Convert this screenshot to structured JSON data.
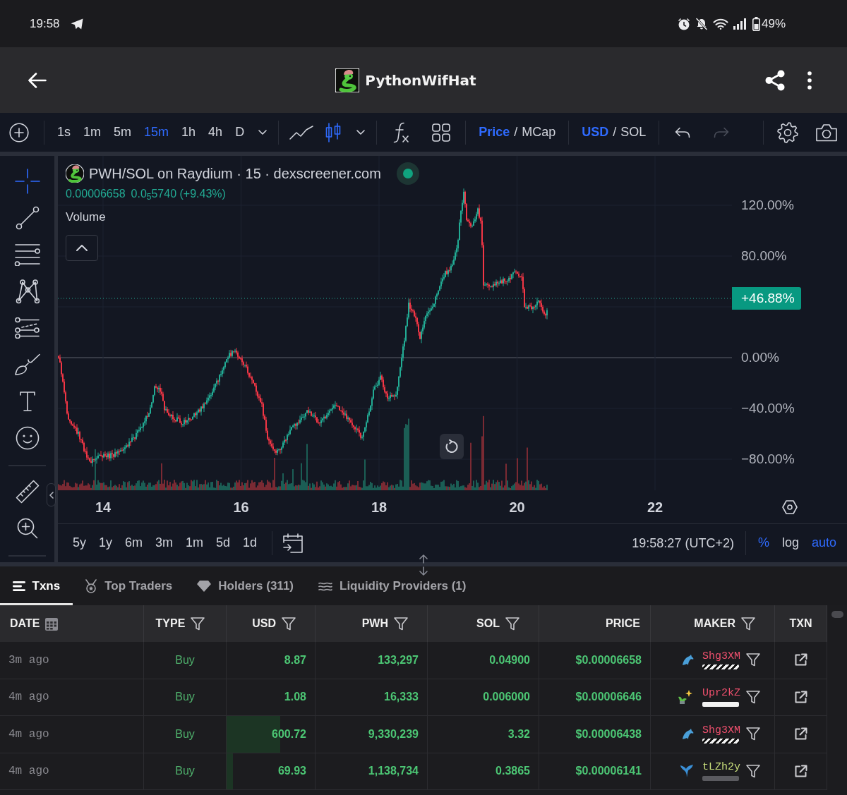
{
  "status_bar": {
    "time": "19:58",
    "battery": "49%"
  },
  "header": {
    "title": "PythonWifHat"
  },
  "toolbar": {
    "intervals": [
      {
        "label": "1s",
        "selected": false
      },
      {
        "label": "1m",
        "selected": false
      },
      {
        "label": "5m",
        "selected": false
      },
      {
        "label": "15m",
        "selected": true
      },
      {
        "label": "1h",
        "selected": false
      },
      {
        "label": "4h",
        "selected": false
      },
      {
        "label": "D",
        "selected": false
      }
    ],
    "chart_styles": [
      {
        "kind": "line",
        "selected": false
      },
      {
        "kind": "candles",
        "selected": true
      }
    ],
    "value_toggle": {
      "options": [
        {
          "label": "Price",
          "selected": true
        },
        {
          "label": "MCap",
          "selected": false
        }
      ],
      "divider": "/"
    },
    "currency_toggle": {
      "options": [
        {
          "label": "USD",
          "selected": true
        },
        {
          "label": "SOL",
          "selected": false
        }
      ],
      "divider": "/"
    },
    "history": [
      {
        "kind": "undo",
        "disabled": false
      },
      {
        "kind": "redo",
        "disabled": true
      }
    ]
  },
  "drawing_tools": [
    [
      {
        "kind": "crosshair",
        "selected": true
      },
      {
        "kind": "trend_line",
        "selected": false
      },
      {
        "kind": "fib_levels",
        "selected": false
      },
      {
        "kind": "pattern",
        "selected": false
      },
      {
        "kind": "projection",
        "selected": false
      },
      {
        "kind": "brush",
        "selected": false
      },
      {
        "kind": "text",
        "selected": false
      },
      {
        "kind": "emoji",
        "selected": false
      }
    ],
    [
      {
        "kind": "measure",
        "selected": false
      },
      {
        "kind": "zoom_in",
        "selected": false
      }
    ]
  ],
  "chart": {
    "legend": {
      "title": "PWH/SOL on Raydium · 15 · dexscreener.com",
      "price": "0.00006658",
      "change": "0.0$_{5}$5740 (+9.43%)",
      "indicator": "Volume",
      "live": true
    },
    "price_axis": [
      {
        "kind": "tick",
        "label": "120.00%"
      },
      {
        "kind": "tick",
        "label": "80.00%"
      },
      {
        "kind": "last",
        "label": "+46.88%"
      },
      {
        "kind": "baseline",
        "label": "0.00%"
      },
      {
        "kind": "tick",
        "label": "−40.00%"
      },
      {
        "kind": "tick",
        "label": "−80.00%"
      }
    ],
    "time_axis": [
      "14",
      "16",
      "18",
      "20",
      "22"
    ],
    "ranges": [
      {
        "label": "5y",
        "selected": false
      },
      {
        "label": "1y",
        "selected": false
      },
      {
        "label": "6m",
        "selected": false
      },
      {
        "label": "3m",
        "selected": false
      },
      {
        "label": "1m",
        "selected": false
      },
      {
        "label": "5d",
        "selected": false
      },
      {
        "label": "1d",
        "selected": false
      }
    ],
    "clock": "19:58:27 (UTC+2)",
    "scale_options": [
      {
        "label": "%",
        "on": true
      },
      {
        "label": "log",
        "on": false
      },
      {
        "label": "auto",
        "on": true
      }
    ]
  },
  "tabs": [
    {
      "label": "Txns",
      "kind": "txns",
      "selected": true
    },
    {
      "label": "Top Traders",
      "kind": "traders",
      "selected": false
    },
    {
      "label": "Holders (311)",
      "kind": "holders",
      "selected": false
    },
    {
      "label": "Liquidity Providers (1)",
      "kind": "liquidity",
      "selected": false
    }
  ],
  "table": {
    "columns": [
      {
        "label": "DATE",
        "kind": "date"
      },
      {
        "label": "TYPE",
        "kind": "filter"
      },
      {
        "label": "USD",
        "kind": "filter"
      },
      {
        "label": "PWH",
        "kind": "filter"
      },
      {
        "label": "SOL",
        "kind": "filter"
      },
      {
        "label": "PRICE",
        "kind": "plain"
      },
      {
        "label": "MAKER",
        "kind": "filter"
      },
      {
        "label": "TXN",
        "kind": "plain"
      }
    ],
    "rows": [
      {
        "date": "3m ago",
        "type": "Buy",
        "kind": "buy",
        "usd": "8.87",
        "pwh": "133,297",
        "sol": "0.04900",
        "price": "$0.00006658",
        "maker": {
          "address": "Shg3XM",
          "kind": "dolphin",
          "color": "#f0506e",
          "holdings": {
            "kind": "striped"
          }
        }
      },
      {
        "date": "4m ago",
        "type": "Buy",
        "kind": "buy",
        "usd": "1.08",
        "pwh": "16,333",
        "sol": "0.006000",
        "price": "$0.00006646",
        "maker": {
          "address": "Upr2kZ",
          "kind": "fresh",
          "color": "#f0506e",
          "holdings": {
            "kind": "solid"
          }
        }
      },
      {
        "date": "4m ago",
        "type": "Buy",
        "kind": "buy",
        "usd": "600.72",
        "level": 0.61,
        "pwh": "9,330,239",
        "sol": "3.32",
        "price": "$0.00006438",
        "maker": {
          "address": "Shg3XM",
          "kind": "dolphin",
          "color": "#f0506e",
          "holdings": {
            "kind": "striped"
          }
        }
      },
      {
        "date": "4m ago",
        "type": "Buy",
        "kind": "buy",
        "usd": "69.93",
        "level": 0.07,
        "pwh": "1,138,734",
        "sol": "0.3865",
        "price": "$0.00006141",
        "maker": {
          "address": "tLZh2y",
          "kind": "whale",
          "color": "#c9df7c",
          "holdings": {
            "kind": "empty"
          }
        }
      }
    ]
  }
}
